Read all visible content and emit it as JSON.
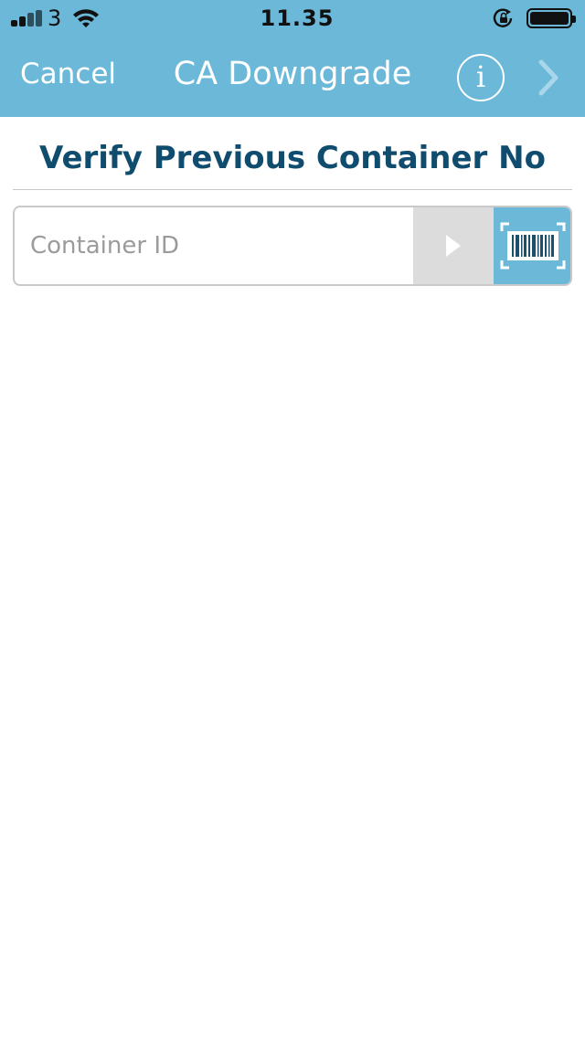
{
  "status_bar": {
    "carrier": "3",
    "time": "11.35",
    "icons": [
      "signal-icon",
      "wifi-icon",
      "rotation-lock-icon",
      "battery-icon"
    ],
    "battery_level": 1.0
  },
  "nav": {
    "cancel_label": "Cancel",
    "title": "CA Downgrade",
    "info_label": "i",
    "info_icon": "info-icon",
    "next_icon": "chevron-right-icon"
  },
  "main": {
    "heading": "Verify Previous Container No",
    "input": {
      "placeholder": "Container ID",
      "value": ""
    },
    "submit_icon": "play-arrow-icon",
    "scan_icon": "barcode-scan-icon"
  },
  "colors": {
    "header_bg": "#6bb8d9",
    "heading_text": "#0f4c6e",
    "submit_bg": "#dcdcdc",
    "scan_bg": "#6bb8d9"
  }
}
